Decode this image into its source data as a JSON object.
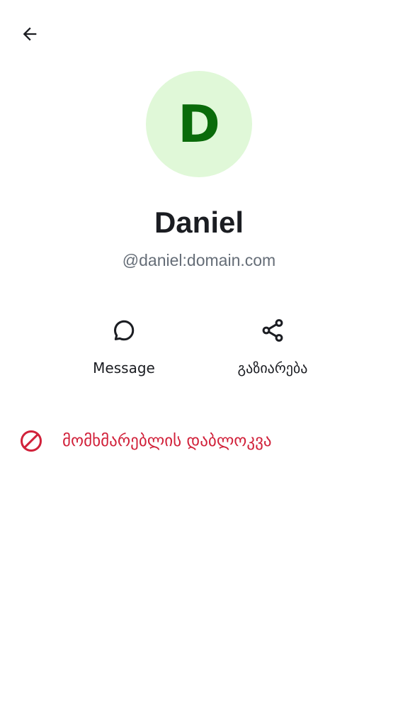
{
  "header": {
    "back_icon": "arrow-left-icon"
  },
  "profile": {
    "avatar_initial": "D",
    "avatar_bg": "#e0f8d8",
    "avatar_fg": "#0a6b0a",
    "display_name": "Daniel",
    "user_id": "@daniel:domain.com"
  },
  "actions": [
    {
      "label": "Message",
      "icon": "chat-bubble-icon"
    },
    {
      "label": "გაზიარება",
      "icon": "share-icon"
    }
  ],
  "block": {
    "label": "მომხმარებლის დაბლოკვა",
    "icon": "block-icon",
    "color": "#d1213a"
  }
}
